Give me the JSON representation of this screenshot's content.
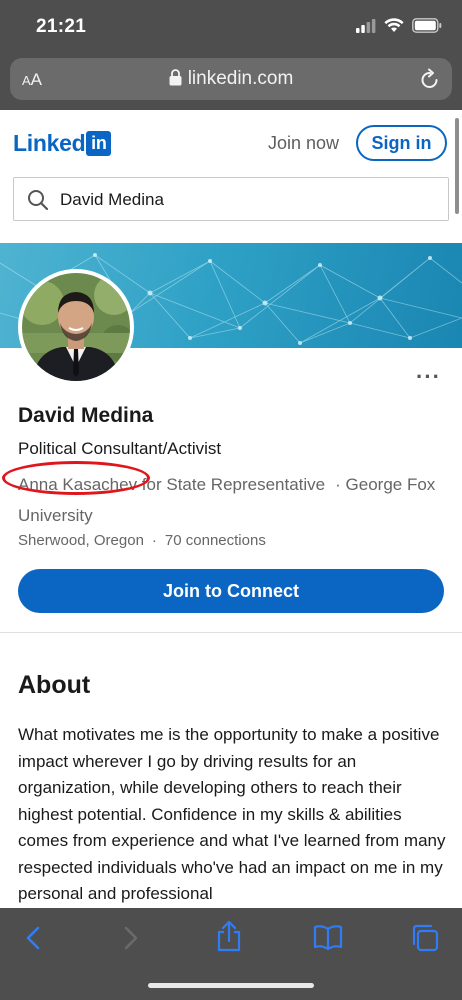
{
  "status_bar": {
    "time": "21:21"
  },
  "browser": {
    "text_size": "AA",
    "url": "linkedin.com"
  },
  "linkedin_header": {
    "logo_text": "Linked",
    "logo_badge": "in",
    "join_now": "Join now",
    "sign_in": "Sign in"
  },
  "search": {
    "value": "David Medina"
  },
  "profile": {
    "name": "David Medina",
    "headline": "Political Consultant/Activist",
    "experience": "Anna Kasachev for State Representative",
    "education": "· George Fox University",
    "location": "Sherwood, Oregon",
    "location_sep": "·",
    "connections": "70 connections",
    "connect_button": "Join to Connect",
    "more_menu": "···"
  },
  "about": {
    "title": "About",
    "text": "What motivates me is the opportunity to make a positive impact wherever I go by driving results for an organization, while developing others to reach their highest potential. Confidence in my skills & abilities comes from experience and what I've learned from many respected individuals who've had an impact on me in my personal and professional"
  },
  "colors": {
    "brand": "#0a66c2",
    "annotation": "#e0161d",
    "chrome": "#4e4e4e",
    "toolbar_icon": "#2f7df6"
  },
  "icons": [
    "signal-icon",
    "wifi-icon",
    "battery-icon",
    "lock-icon",
    "reload-icon",
    "search-icon",
    "back-icon",
    "forward-icon",
    "share-icon",
    "bookmarks-icon",
    "tabs-icon"
  ]
}
